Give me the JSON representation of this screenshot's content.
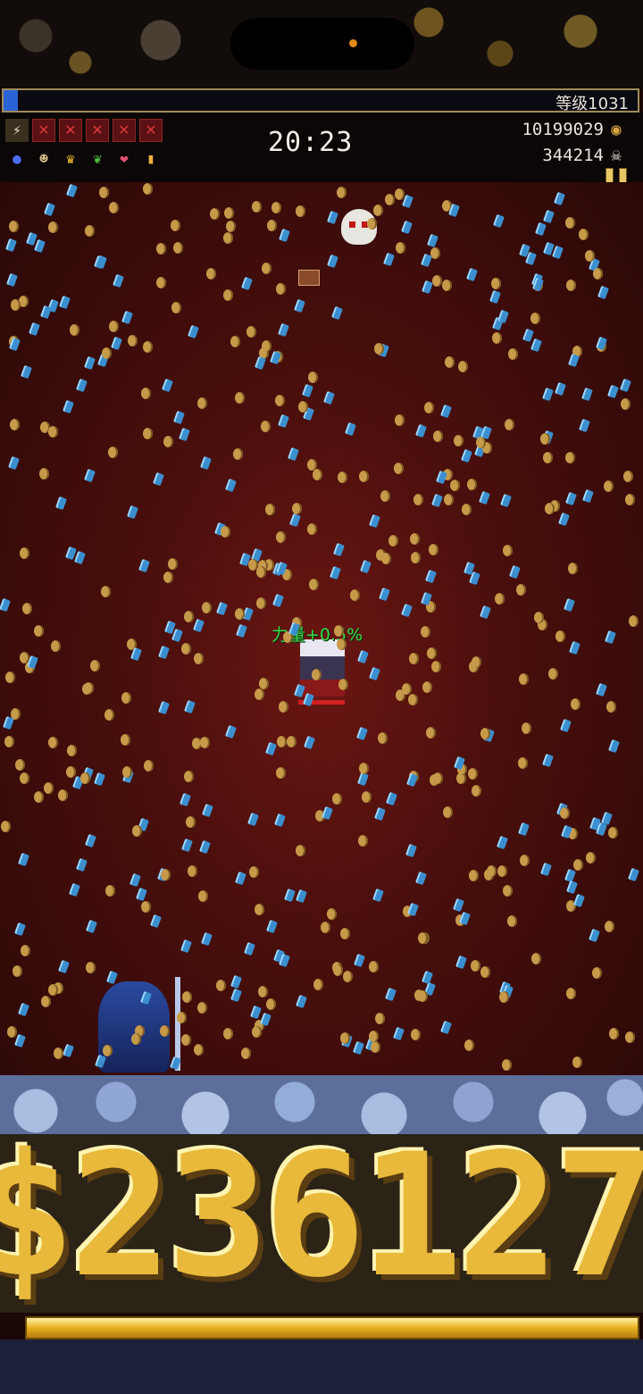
{
  "hud": {
    "level_label": "等级1031",
    "xp_fraction": 0.022,
    "timer": "20:23",
    "gold": "10199029",
    "kills": "344214",
    "weapon_slots": [
      "lightning-ring-icon",
      "empty",
      "empty",
      "empty",
      "empty",
      "empty"
    ],
    "passive_slots": [
      "orb-icon",
      "face-icon",
      "crown-icon",
      "leaf-icon",
      "heart-icon",
      "candle-icon"
    ],
    "arcana_slots": [
      "eye-icon",
      "green-orb-icon",
      "arrow-icon"
    ]
  },
  "field": {
    "buff_text": "力量+0.5%"
  },
  "bottom": {
    "coin_counter": "236127",
    "gold_bar_fill": 1.0
  },
  "colors": {
    "gold": "#e8b93a",
    "gem": "#3b8fcf",
    "coin": "#c79a4a",
    "buff_green": "#39d84b",
    "xp_blue": "#2a63d6"
  }
}
